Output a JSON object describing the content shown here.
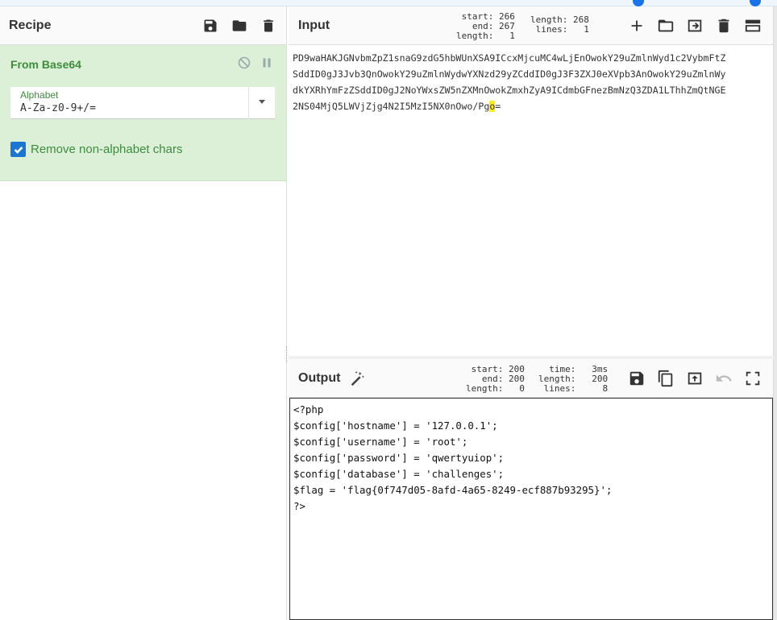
{
  "recipe": {
    "title": "Recipe",
    "operation": {
      "name": "From Base64",
      "alphabet_label": "Alphabet",
      "alphabet_value": "A-Za-z0-9+/=",
      "remove_nonalpha_label": "Remove non-alphabet chars",
      "remove_nonalpha_checked": true
    }
  },
  "input": {
    "title": "Input",
    "stats_left": "start: 266\n  end: 267\nlength:   1",
    "stats_right": "length: 268\n lines:   1",
    "lines": [
      "PD9waHAKJGNvbmZpZ1snaG9zdG5hbWUnXSA9ICcxMjcuMC4wLjEnOwokY29uZmlnWyd1c2VybmFtZ",
      "SddID0gJ3Jvb3QnOwokY29uZmlnWydwYXNzd29yZCddID0gJ3F3ZXJ0eXVpb3AnOwokY29uZmlnWy",
      "dkYXRhYmFzZSddID0gJ2NoYWxsZW5nZXMnOwokZmxhZyA9ICdmbGFnezBmNzQ3ZDA1LThhZmQtNGE",
      "2NS04MjQ5LWVjZjg4N2I5MzI5NX0nOwo/Pg",
      "o",
      "="
    ]
  },
  "output": {
    "title": "Output",
    "stats_left": "start: 200\n  end: 200\nlength:   0",
    "stats_right": " time:   3ms\nlength:   200\n lines:     8",
    "lines": [
      "<?php",
      "$config['hostname'] = '127.0.0.1';",
      "$config['username'] = 'root';",
      "$config['password'] = 'qwertyuiop';",
      "$config['database'] = 'challenges';",
      "$flag = 'flag{0f747d05-8afd-4a65-8249-ecf887b93295}';",
      "?>"
    ]
  },
  "colors": {
    "op_bg": "#dcf0d8",
    "op_text": "#3c8d3c",
    "checkbox": "#1976d2",
    "highlight": "#fff200"
  }
}
